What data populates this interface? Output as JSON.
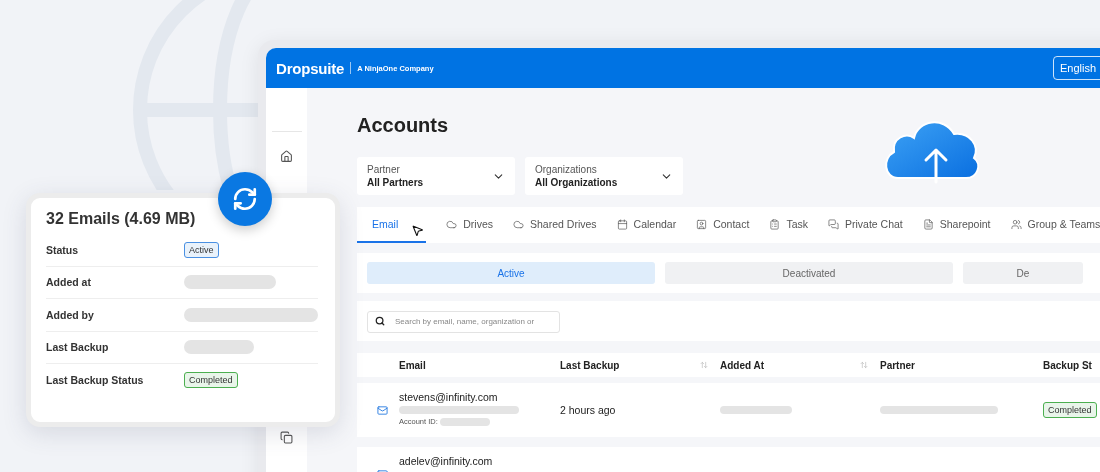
{
  "header": {
    "logo": "Dropsuite",
    "tagline": "A NinjaOne Company",
    "language": "English"
  },
  "page": {
    "title": "Accounts"
  },
  "filters": [
    {
      "label": "Partner",
      "value": "All Partners"
    },
    {
      "label": "Organizations",
      "value": "All Organizations"
    }
  ],
  "tabs": [
    {
      "label": "Email",
      "selected": true
    },
    {
      "label": "Drives",
      "selected": false
    },
    {
      "label": "Shared Drives",
      "selected": false
    },
    {
      "label": "Calendar",
      "selected": false
    },
    {
      "label": "Contact",
      "selected": false
    },
    {
      "label": "Task",
      "selected": false
    },
    {
      "label": "Private Chat",
      "selected": false
    },
    {
      "label": "Sharepoint",
      "selected": false
    },
    {
      "label": "Group & Teams",
      "selected": false
    }
  ],
  "status_tabs": [
    {
      "label": "Active",
      "selected": true
    },
    {
      "label": "Deactivated",
      "selected": false
    },
    {
      "label": "De",
      "selected": false
    }
  ],
  "search": {
    "placeholder": "Search by email, name, organization or"
  },
  "table": {
    "columns": [
      {
        "label": "Email",
        "sortable": false
      },
      {
        "label": "Last Backup",
        "sortable": true
      },
      {
        "label": "Added At",
        "sortable": true
      },
      {
        "label": "Partner",
        "sortable": false
      },
      {
        "label": "Backup St",
        "sortable": false
      }
    ],
    "rows": [
      {
        "email": "stevens@infinity.com",
        "account_id_label": "Account ID:",
        "last_backup": "2 hours ago",
        "status": "Completed"
      },
      {
        "email": "adelev@infinity.com"
      }
    ]
  },
  "card": {
    "title": "32 Emails (4.69 MB)",
    "rows": [
      {
        "label": "Status",
        "kind": "badge",
        "color": "#4a90e2",
        "value": "Active"
      },
      {
        "label": "Added at",
        "kind": "placeholder"
      },
      {
        "label": "Added by",
        "kind": "placeholder"
      },
      {
        "label": "Last Backup",
        "kind": "placeholder"
      },
      {
        "label": "Last Backup Status",
        "kind": "badge",
        "color": "#4caf50",
        "value": "Completed"
      }
    ]
  }
}
